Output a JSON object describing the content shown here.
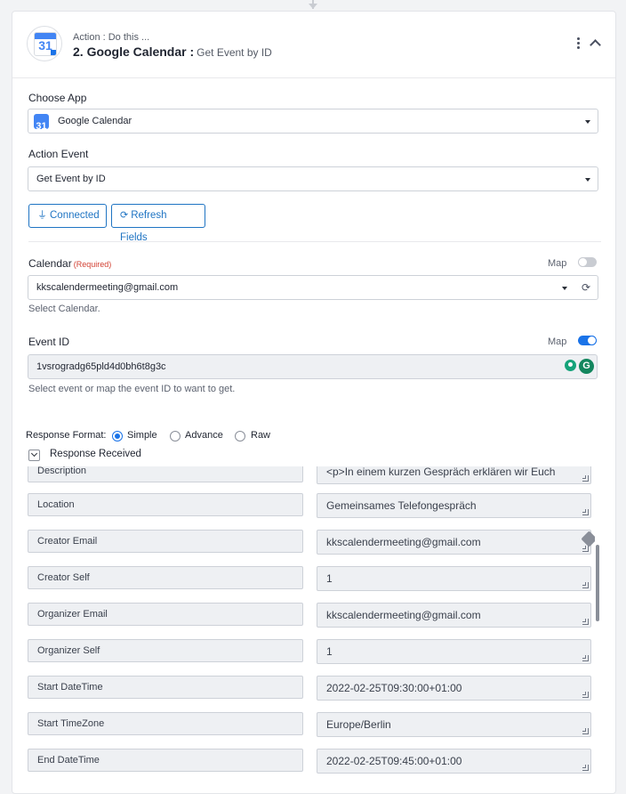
{
  "header": {
    "subtitle": "Action : Do this ...",
    "title": "2. Google Calendar :",
    "title_sub": "Get Event by ID",
    "logo_day": "31"
  },
  "choose_app": {
    "label": "Choose App",
    "value": "Google Calendar",
    "logo_day": "31"
  },
  "action_event": {
    "label": "Action Event",
    "value": "Get Event by ID"
  },
  "buttons": {
    "connected": "Connected",
    "refresh": "Refresh Fields"
  },
  "calendar": {
    "label": "Calendar",
    "required": "(Required)",
    "map_label": "Map",
    "map_on": false,
    "value": "kkscalendermeeting@gmail.com",
    "hint": "Select Calendar."
  },
  "event_id": {
    "label": "Event ID",
    "map_label": "Map",
    "map_on": true,
    "value": "1vsrogradg65pld4d0bh6t8g3c",
    "hint": "Select event or map the event ID to want to get."
  },
  "response_format": {
    "label": "Response Format:",
    "options": [
      "Simple",
      "Advance",
      "Raw"
    ],
    "selected": "Simple"
  },
  "response_received": {
    "title": "Response Received",
    "rows": [
      {
        "key": "Description",
        "value": "<p>In einem kurzen Gespräch erklären wir Euch"
      },
      {
        "key": "Location",
        "value": "Gemeinsames Telefongespräch"
      },
      {
        "key": "Creator Email",
        "value": "kkscalendermeeting@gmail.com"
      },
      {
        "key": "Creator Self",
        "value": "1"
      },
      {
        "key": "Organizer Email",
        "value": "kkscalendermeeting@gmail.com"
      },
      {
        "key": "Organizer Self",
        "value": "1"
      },
      {
        "key": "Start DateTime",
        "value": "2022-02-25T09:30:00+01:00"
      },
      {
        "key": "Start TimeZone",
        "value": "Europe/Berlin"
      },
      {
        "key": "End DateTime",
        "value": "2022-02-25T09:45:00+01:00"
      }
    ]
  },
  "colors": {
    "accent": "#1a73e8",
    "button_blue": "#1f74c3",
    "required_red": "#d23f31"
  }
}
